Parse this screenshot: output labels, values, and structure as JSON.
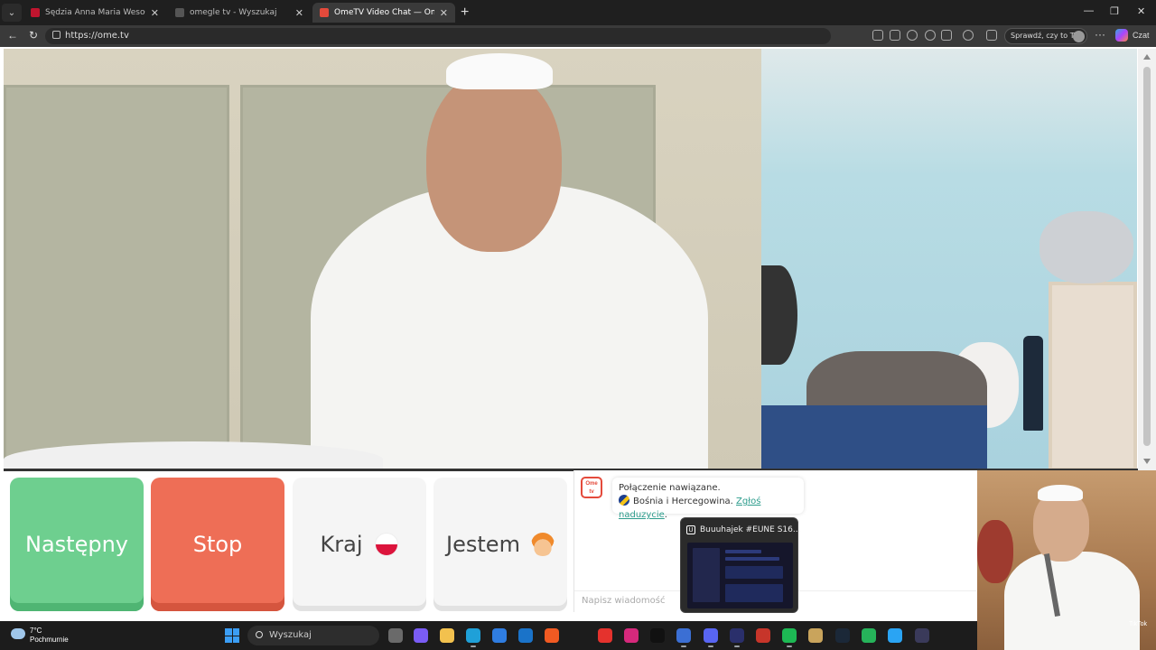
{
  "browser": {
    "tabs": [
      {
        "title": "Sędzia Anna Maria Wesołowska o",
        "favicon_color": "#c0152f",
        "active": false
      },
      {
        "title": "omegle tv - Wyszukaj",
        "favicon_color": "#555555",
        "active": false
      },
      {
        "title": "OmeTV Video Chat — Omegle",
        "favicon_color": "#e44a3b",
        "active": true
      }
    ],
    "url": "https://ome.tv",
    "profile_label": "Sprawdź, czy to Ty",
    "copilot_label": "Czat"
  },
  "controls": {
    "next_label": "Następny",
    "stop_label": "Stop",
    "country_label": "Kraj",
    "gender_label": "Jestem"
  },
  "chat": {
    "logo_text": "Ome tv",
    "status_message": "Połączenie nawiązane.",
    "partner_country": "Bośnia i Hercegowina.",
    "report_link": "Zgłoś naduzycie",
    "input_placeholder": "Napisz wiadomość"
  },
  "taskbar_preview": {
    "title": "Buuuhajek #EUNE S16..."
  },
  "taskbar": {
    "weather_temp": "7°C",
    "weather_desc": "Pochmurnie",
    "search_label": "Wyszukaj",
    "apps": [
      {
        "name": "task-view-icon",
        "color": "#6a6a6a"
      },
      {
        "name": "copilot-icon",
        "color": "#7a5cf5"
      },
      {
        "name": "file-explorer-icon",
        "color": "#f2c14e"
      },
      {
        "name": "edge-icon",
        "color": "#1fa0d8"
      },
      {
        "name": "store-icon",
        "color": "#2f7de1"
      },
      {
        "name": "outlook-icon",
        "color": "#1a73c9"
      },
      {
        "name": "brave-icon",
        "color": "#f15a22"
      },
      {
        "name": "wps-icon",
        "color": "#e5322d"
      },
      {
        "name": "instagram-icon",
        "color": "#d6297c"
      },
      {
        "name": "tiktok-icon",
        "color": "#111111"
      },
      {
        "name": "news-app-icon",
        "color": "#3b6fd4"
      },
      {
        "name": "discord-icon",
        "color": "#5865f2"
      },
      {
        "name": "u-gg-icon",
        "color": "#2a2f6b"
      },
      {
        "name": "game-app-icon",
        "color": "#c7352a"
      },
      {
        "name": "spotify-icon",
        "color": "#1db954"
      },
      {
        "name": "league-icon",
        "color": "#c9a45c"
      },
      {
        "name": "steam-icon",
        "color": "#1b2838"
      },
      {
        "name": "messenger-app-icon",
        "color": "#26b35a"
      },
      {
        "name": "bolt-app-icon",
        "color": "#2aa4f4"
      },
      {
        "name": "obs-icon",
        "color": "#3a3a5a"
      }
    ]
  },
  "webcam_overlay": {
    "watermark": "TikTok"
  }
}
